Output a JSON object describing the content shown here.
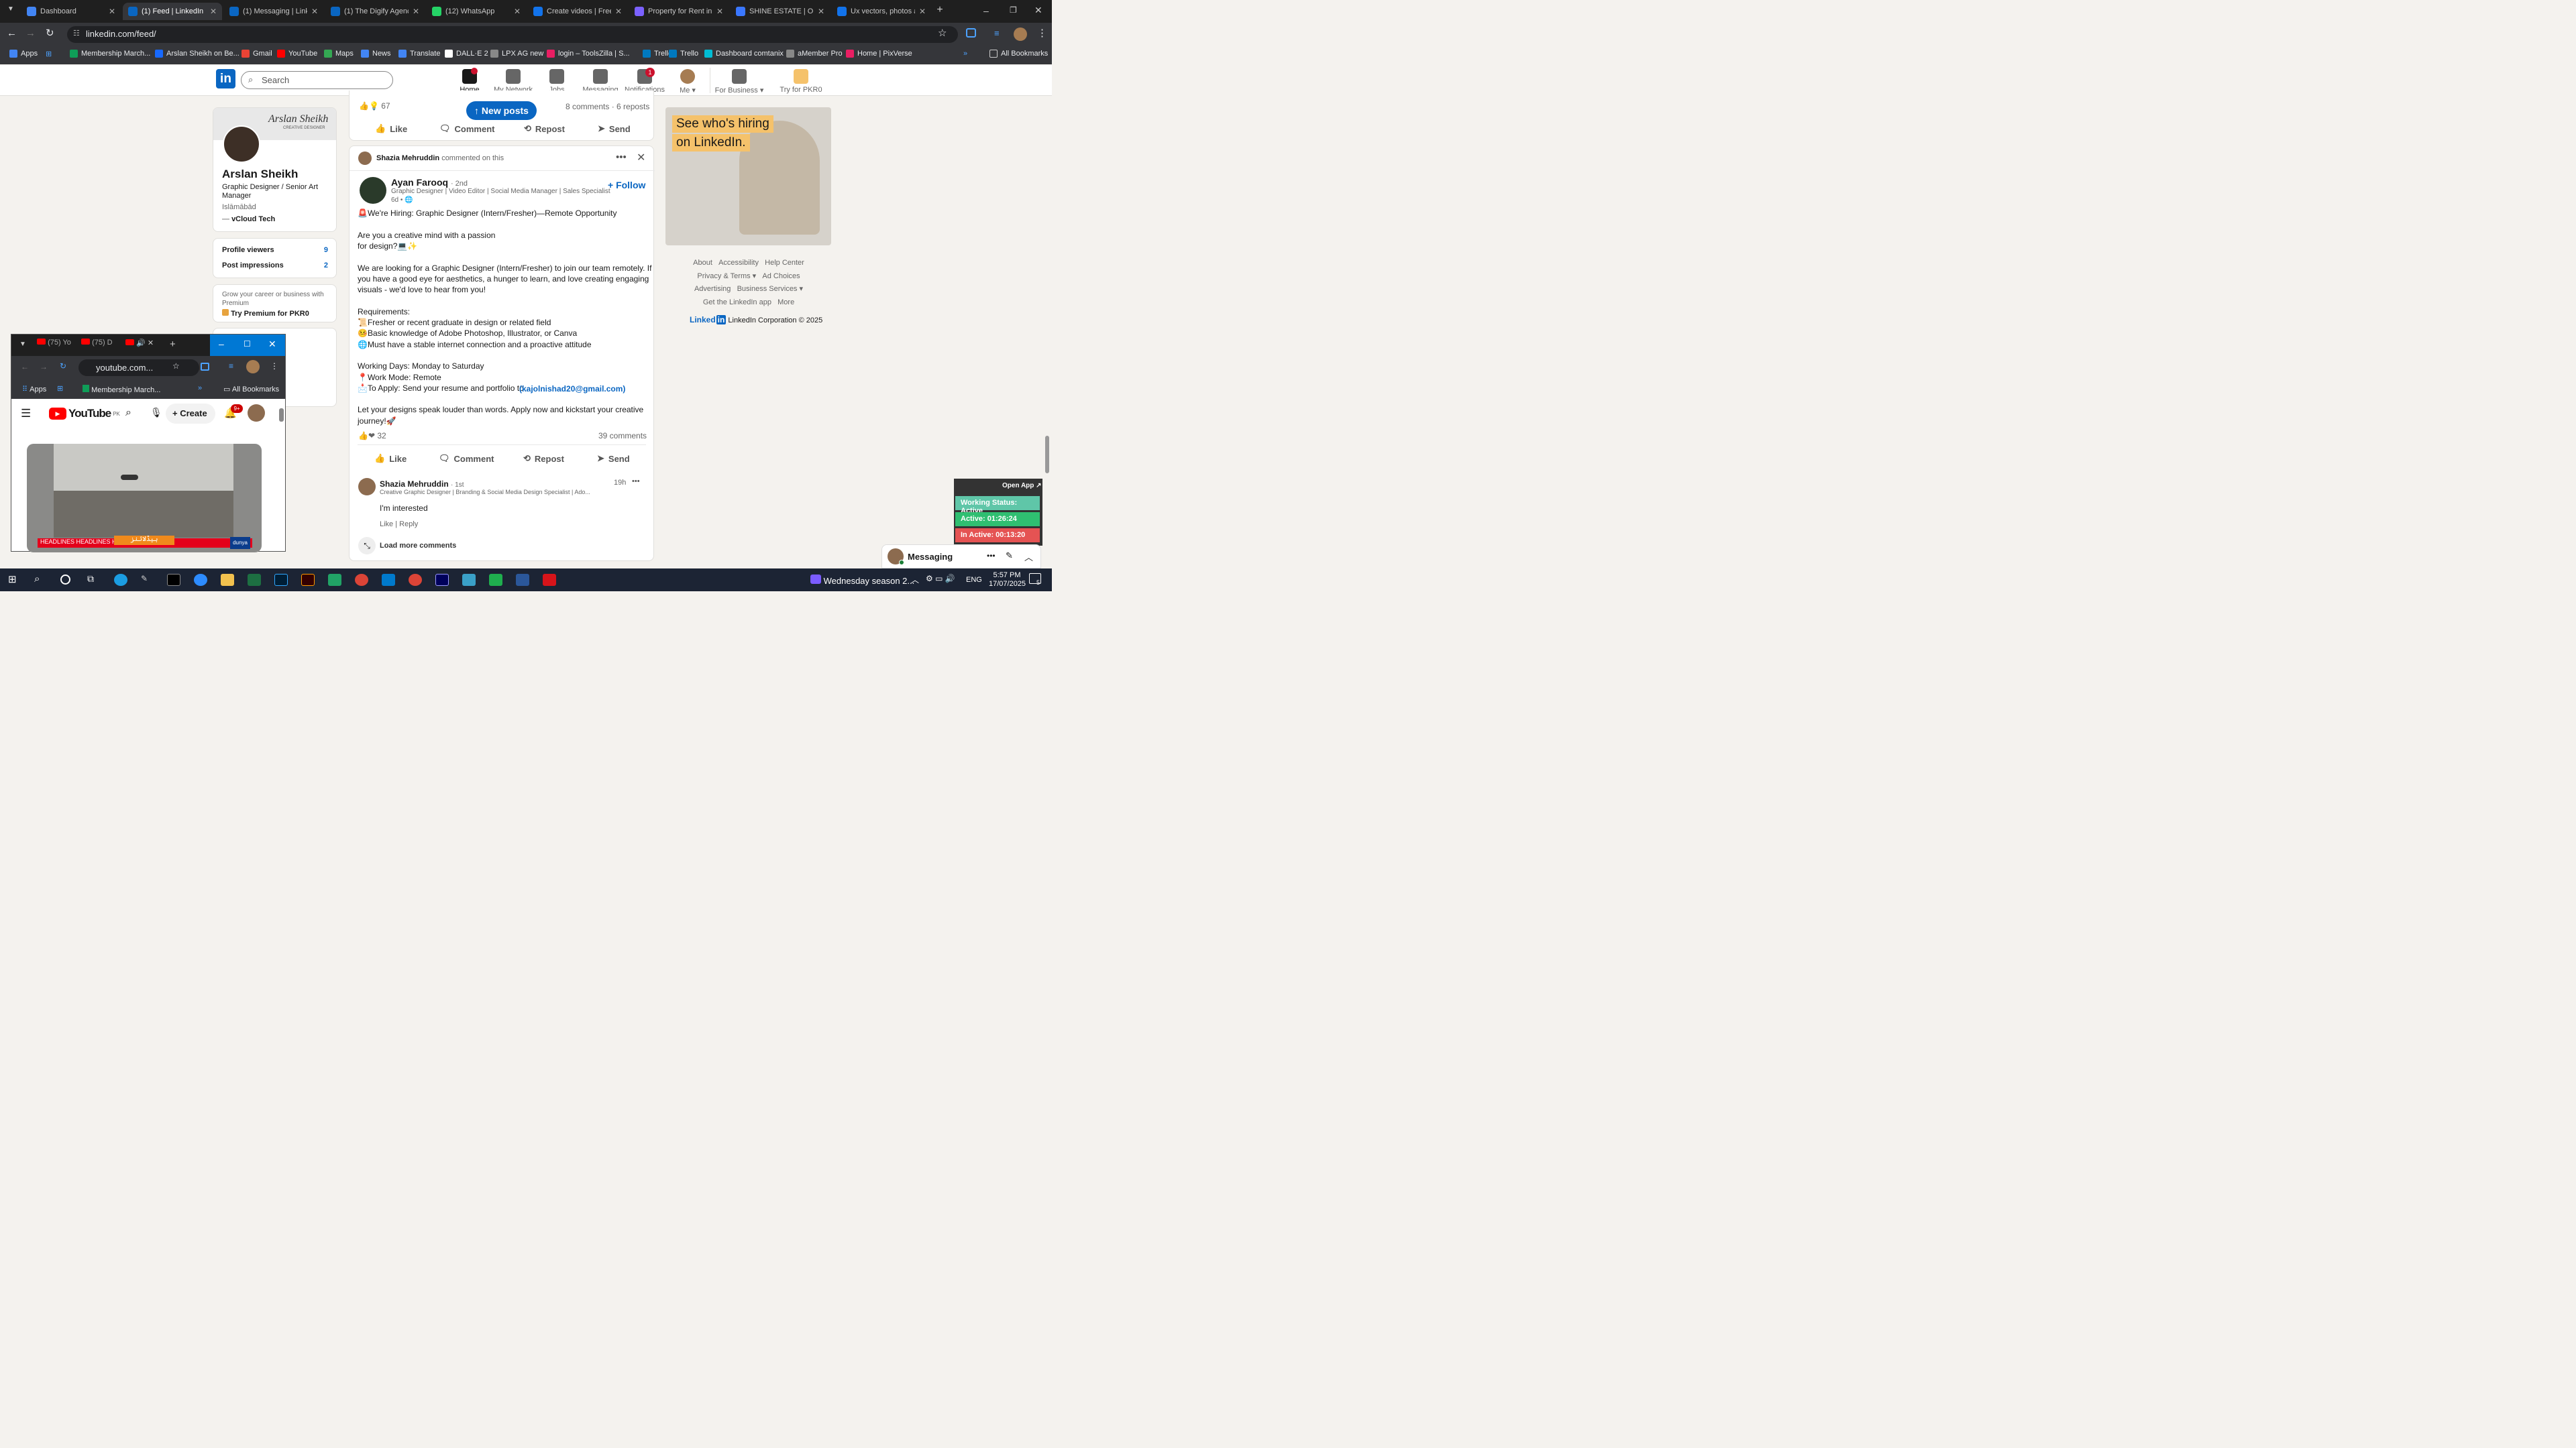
{
  "browser": {
    "tabs": [
      {
        "label": "Dashboard",
        "color": "#4285f4"
      },
      {
        "label": "(1) Feed | LinkedIn",
        "color": "#0a66c2"
      },
      {
        "label": "(1) Messaging | Linke",
        "color": "#0a66c2"
      },
      {
        "label": "(1) The Digify Agency",
        "color": "#0a66c2"
      },
      {
        "label": "(12) WhatsApp",
        "color": "#25d366"
      },
      {
        "label": "Create videos | Freep",
        "color": "#1273eb"
      },
      {
        "label": "Property for Rent in S",
        "color": "#7b61ff"
      },
      {
        "label": "SHINE ESTATE | OLX",
        "color": "#3a77ff"
      },
      {
        "label": "Ux vectors, photos an",
        "color": "#1273eb"
      }
    ],
    "url": "linkedin.com/feed/",
    "bookmarks": [
      {
        "label": "Apps",
        "color": "#4285f4"
      },
      {
        "label": "Membership March...",
        "color": "#0f9d58"
      },
      {
        "label": "Arslan Sheikh on Be...",
        "color": "#1769ff"
      },
      {
        "label": "Gmail",
        "color": "#ea4335"
      },
      {
        "label": "YouTube",
        "color": "#ff0000"
      },
      {
        "label": "Maps",
        "color": "#34a853"
      },
      {
        "label": "News",
        "color": "#4285f4"
      },
      {
        "label": "Translate",
        "color": "#4285f4"
      },
      {
        "label": "DALL·E 2",
        "color": "#ffffff"
      },
      {
        "label": "LPX AG new",
        "color": "#888888"
      },
      {
        "label": "login – ToolsZilla | S...",
        "color": "#e91e63"
      },
      {
        "label": "Trello",
        "color": "#0079bf"
      },
      {
        "label": "Trello",
        "color": "#0079bf"
      },
      {
        "label": "Dashboard comtanix",
        "color": "#00bcd4"
      },
      {
        "label": "aMember Pro",
        "color": "#888888"
      },
      {
        "label": "Home | PixVerse",
        "color": "#e91e63"
      }
    ],
    "all_bookmarks": "All Bookmarks"
  },
  "nav": {
    "search_placeholder": "Search",
    "items": [
      {
        "label": "Home",
        "badge": ""
      },
      {
        "label": "My Network",
        "badge": ""
      },
      {
        "label": "Jobs",
        "badge": ""
      },
      {
        "label": "Messaging",
        "badge": ""
      },
      {
        "label": "Notifications",
        "badge": "1"
      },
      {
        "label": "Me ▾",
        "badge": ""
      },
      {
        "label": "For Business ▾",
        "badge": ""
      },
      {
        "label": "Try for PKR0",
        "badge": ""
      }
    ]
  },
  "profile": {
    "name": "Arslan Sheikh",
    "banner_text": "Arslan Sheikh",
    "banner_sub": "CREATIVE DESIGNER",
    "headline": "Graphic Designer / Senior Art Manager",
    "location": "Islāmābād",
    "company": "vCloud Tech",
    "stats": [
      {
        "label": "Profile viewers",
        "value": "9"
      },
      {
        "label": "Post impressions",
        "value": "2"
      }
    ],
    "premium_text": "Grow your career or business with Premium",
    "premium_link": "Try Premium for PKR0"
  },
  "feed": {
    "prev_reactions": "67",
    "prev_stats": "8 comments · 6 reposts",
    "new_posts": "↑ New posts",
    "actions": [
      "Like",
      "Comment",
      "Repost",
      "Send"
    ],
    "context_name": "Shazia Mehruddin",
    "context_text": "commented on this",
    "author": {
      "name": "Ayan Farooq",
      "degree": "· 2nd",
      "headline": "Graphic Designer | Video Editor | Social Media Manager | Sales Specialist",
      "time": "6d •"
    },
    "follow": "+ Follow",
    "body": [
      "🚨We're Hiring: Graphic Designer (Intern/Fresher)—Remote Opportunity",
      "",
      "Are you a creative mind with a passion",
      "for design?💻✨",
      "",
      "We are looking for a Graphic Designer (Intern/Fresher) to join our team remotely. If",
      "you have a good eye for aesthetics, a hunger to learn, and love creating engaging",
      "visuals - we'd love to hear from you!",
      "",
      "Requirements:",
      "📜Fresher or recent graduate in design or related field",
      "🤒Basic knowledge of Adobe Photoshop, Illustrator, or Canva",
      "🌐Must have a stable internet connection and a proactive attitude",
      "",
      "Working Days: Monday to Saturday",
      "📍Work Mode: Remote",
      "📩To Apply: Send your resume and portfolio to",
      "",
      "Let your designs speak louder than words. Apply now and kickstart your creative",
      "journey!🚀"
    ],
    "email": "(kajolnishad20@gmail.com)",
    "reactions": "32",
    "comments_count": "39 comments",
    "comment": {
      "name": "Shazia Mehruddin",
      "degree": "· 1st",
      "headline": "Creative Graphic Designer | Branding & Social Media Design Specialist | Ado...",
      "time": "19h",
      "text": "I'm interested",
      "like": "Like",
      "reply": "Reply"
    },
    "load_more": "Load more comments"
  },
  "ad": {
    "line1": "See who's hiring",
    "line2": "on LinkedIn."
  },
  "footer": {
    "links": [
      "About",
      "Accessibility",
      "Help Center",
      "Privacy & Terms ▾",
      "Ad Choices",
      "Advertising",
      "Business Services ▾",
      "Get the LinkedIn app",
      "More"
    ],
    "brand": "Linked",
    "brand_in": "in",
    "copyright": "LinkedIn Corporation © 2025"
  },
  "youtube": {
    "tabs": [
      "(75) Yo",
      "(75) D"
    ],
    "url": "youtube.com...",
    "bookmarks": [
      "Apps",
      "Membership March..."
    ],
    "all_bookmarks": "All Bookmarks",
    "logo": "YouTube",
    "region": "PK",
    "create": "Create",
    "notif": "9+",
    "ticker": "HEADLINES   HEADLINES   HEADLINES",
    "ticker_mid": "ہیڈلائنز",
    "channel": "dunya"
  },
  "work": {
    "open": "Open App ↗",
    "status": "Working Status: Active",
    "active": "Active: 01:26:24",
    "inactive": "In Active: 00:13:20"
  },
  "messaging": {
    "label": "Messaging"
  },
  "taskbar": {
    "media": "Wednesday season 2...",
    "lang": "ENG",
    "time": "5:57 PM",
    "date": "17/07/2025",
    "notif": "5"
  }
}
